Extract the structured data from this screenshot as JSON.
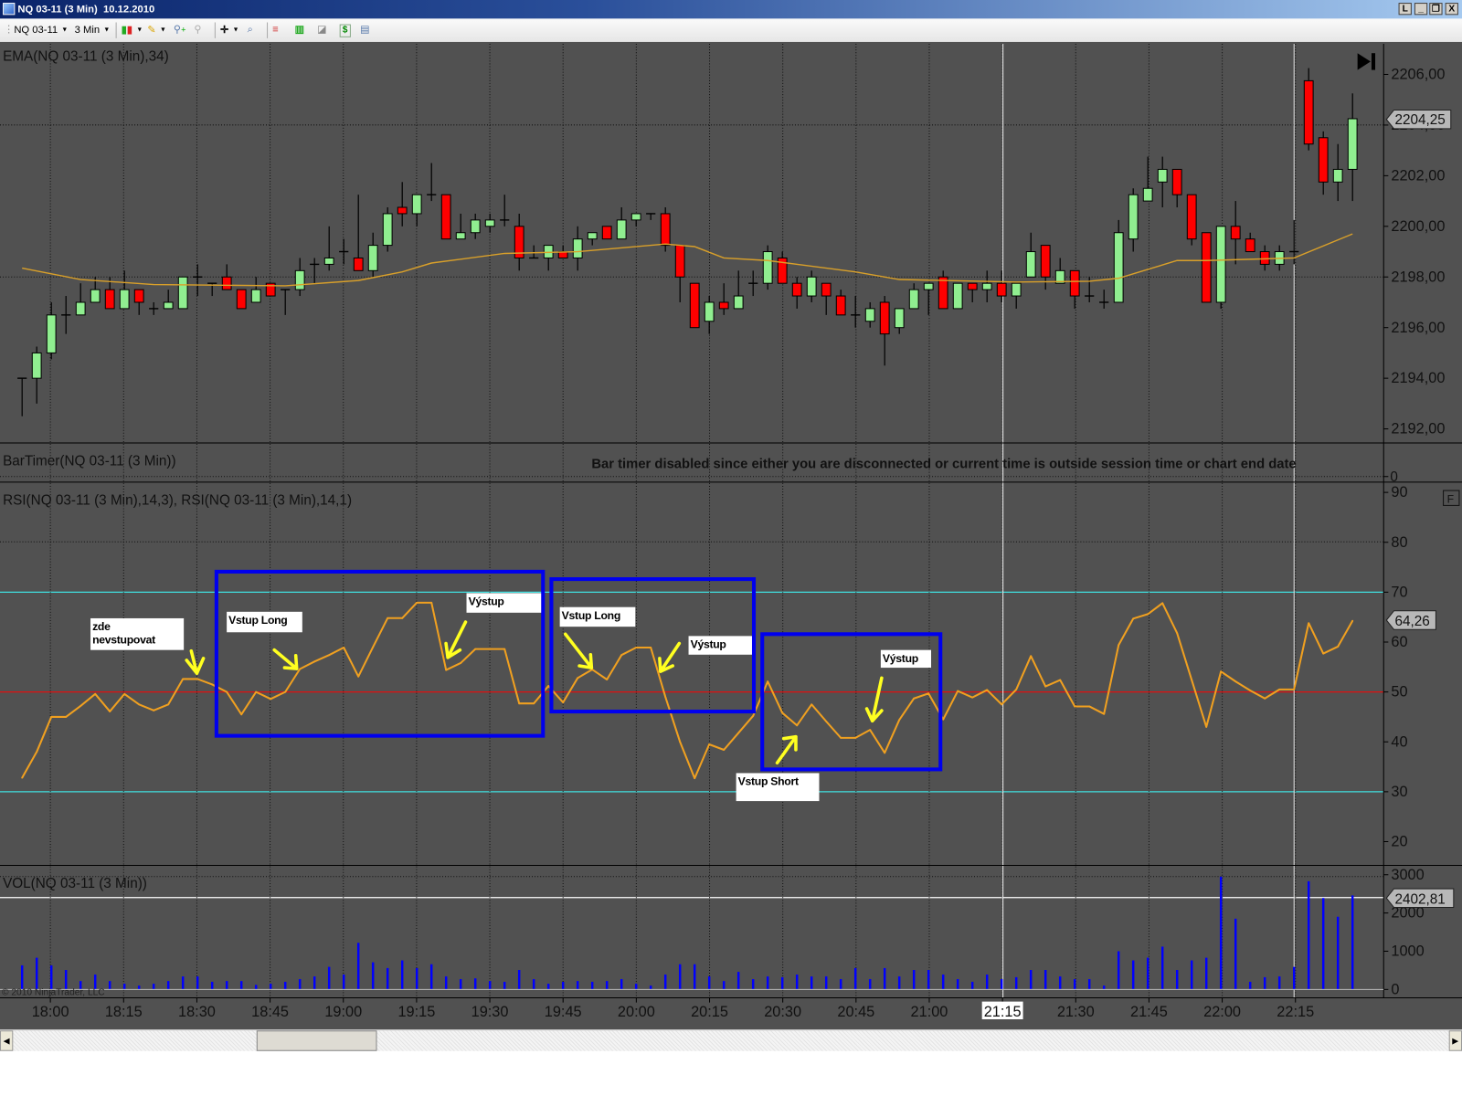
{
  "window": {
    "title": "NQ 03-11 (3 Min)  10.12.2010",
    "buttons": {
      "link": "L",
      "minimize": "_",
      "restore": "❐",
      "close": "X"
    }
  },
  "toolbar": {
    "instrument": "NQ 03-11",
    "interval": "3 Min",
    "icons": [
      "chart-style-icon",
      "drawing-pencil-icon",
      "zoom-in-icon",
      "zoom-out-icon",
      "crosshair-icon",
      "magnifier-icon",
      "strategies-icon",
      "indicators-icon",
      "data-box-icon",
      "order-entry-icon",
      "properties-icon"
    ]
  },
  "panels": {
    "price": {
      "label": "EMA(NQ 03-11 (3 Min),34)",
      "axis_labels": [
        "2206,00",
        "2204,00",
        "2202,00",
        "2200,00",
        "2198,00",
        "2196,00",
        "2194,00",
        "2192,00"
      ],
      "last_price": "2204,25"
    },
    "bartimer": {
      "label": "BarTimer(NQ 03-11 (3 Min))",
      "message": "Bar timer disabled since either you are disconnected or current time is outside session time or chart end date",
      "axis_label": "0"
    },
    "rsi": {
      "label": "RSI(NQ 03-11 (3 Min),14,3), RSI(NQ 03-11 (3 Min),14,1)",
      "axis_labels": [
        "90",
        "80",
        "70",
        "60",
        "50",
        "40",
        "30",
        "20"
      ],
      "last_value": "64,26",
      "f_button": "F",
      "upper_level": 70,
      "mid_level": 50,
      "lower_level": 30
    },
    "volume": {
      "label": "VOL(NQ 03-11 (3 Min))",
      "axis_labels": [
        "3000",
        "2000",
        "1000",
        "0"
      ],
      "last_value": "2402,81"
    }
  },
  "time_axis": {
    "labels": [
      "18:00",
      "18:15",
      "18:30",
      "18:45",
      "19:00",
      "19:15",
      "19:30",
      "19:45",
      "20:00",
      "20:15",
      "20:30",
      "20:45",
      "21:00",
      "21:15",
      "21:30",
      "21:45",
      "22:00",
      "22:15"
    ],
    "highlighted": "21:15"
  },
  "copyright": "© 2010 NinjaTrader, LLC",
  "annotations": {
    "no_entry_line1": "zde",
    "no_entry_line2": "nevstupovat",
    "long_entry_1": "Vstup Long",
    "exit_1": "Výstup",
    "long_entry_2": "Vstup Long",
    "exit_2": "Výstup",
    "short_entry": "Vstup Short",
    "exit_3": "Výstup"
  },
  "colors": {
    "background": "#515151",
    "up_candle": "#90ee90",
    "down_candle": "#ff0000",
    "ema": "#d9a02a",
    "rsi": "#f0a020",
    "rsi_bands": "#40e0e0",
    "rsi_mid": "#e01010",
    "volume": "#0000ff",
    "annotation_box": "#0000ee",
    "annotation_arrow": "#ffff20"
  },
  "chart_data": {
    "type": "candlestick",
    "instrument": "NQ 03-11",
    "interval": "3 Min",
    "times": [
      "17:54",
      "17:57",
      "18:00",
      "18:03",
      "18:06",
      "18:09",
      "18:12",
      "18:15",
      "18:18",
      "18:21",
      "18:24",
      "18:27",
      "18:30",
      "18:33",
      "18:36",
      "18:39",
      "18:42",
      "18:45",
      "18:48",
      "18:51",
      "18:54",
      "18:57",
      "19:00",
      "19:03",
      "19:06",
      "19:09",
      "19:12",
      "19:15",
      "19:18",
      "19:21",
      "19:24",
      "19:27",
      "19:30",
      "19:33",
      "19:36",
      "19:39",
      "19:42",
      "19:45",
      "19:48",
      "19:51",
      "19:54",
      "19:57",
      "20:00",
      "20:03",
      "20:06",
      "20:09",
      "20:12",
      "20:15",
      "20:18",
      "20:21",
      "20:24",
      "20:27",
      "20:30",
      "20:33",
      "20:36",
      "20:39",
      "20:42",
      "20:45",
      "20:48",
      "20:51",
      "20:54",
      "20:57",
      "21:00",
      "21:03",
      "21:06",
      "21:09",
      "21:12",
      "21:15",
      "21:18",
      "21:21",
      "21:24",
      "21:27",
      "21:30",
      "21:33",
      "21:36",
      "21:39",
      "21:42",
      "21:45",
      "21:48",
      "21:51",
      "21:54",
      "21:57",
      "22:00",
      "22:03",
      "22:06",
      "22:09",
      "22:12",
      "22:15",
      "22:18",
      "22:21",
      "22:24",
      "22:27"
    ],
    "open": [
      2194,
      2194,
      2195,
      2196.5,
      2196.5,
      2197,
      2197.5,
      2196.75,
      2197.5,
      2196.75,
      2196.75,
      2196.75,
      2198,
      2197.75,
      2198,
      2197.5,
      2197,
      2197.75,
      2197.5,
      2197.5,
      2198.5,
      2198.5,
      2199,
      2198.75,
      2198.25,
      2199.25,
      2200.75,
      2200.5,
      2201.25,
      2201.25,
      2199.5,
      2199.75,
      2200,
      2200.25,
      2200,
      2198.75,
      2198.75,
      2199,
      2198.75,
      2199.5,
      2200,
      2199.5,
      2200.25,
      2200.5,
      2200.5,
      2199.25,
      2197.75,
      2196.25,
      2197,
      2196.75,
      2197.75,
      2197.75,
      2198.75,
      2197.75,
      2197.25,
      2197.75,
      2197.25,
      2196.5,
      2196.25,
      2197,
      2196,
      2196.75,
      2197.5,
      2198,
      2196.75,
      2197.75,
      2197.5,
      2197.75,
      2197.25,
      2198,
      2199.25,
      2197.75,
      2198.25,
      2197.25,
      2197,
      2197,
      2199.5,
      2201,
      2201.75,
      2202.25,
      2201.25,
      2199.75,
      2197,
      2200,
      2199.5,
      2199,
      2198.5,
      2199,
      2205.75,
      2203.5,
      2201.75,
      2202.25
    ],
    "high": [
      2194,
      2195.25,
      2197,
      2197.25,
      2197.75,
      2198,
      2198,
      2198.25,
      2197.5,
      2197,
      2197.5,
      2198,
      2198.5,
      2197.75,
      2198.5,
      2197.5,
      2198,
      2197.75,
      2197.5,
      2198.75,
      2198.75,
      2200,
      2199.5,
      2201.25,
      2199.75,
      2200.75,
      2201.75,
      2201.25,
      2202.5,
      2201.25,
      2200.5,
      2200.5,
      2200.5,
      2201.25,
      2200.5,
      2199.25,
      2199.25,
      2199.25,
      2200,
      2199.75,
      2200,
      2200.75,
      2200.5,
      2200.5,
      2200.75,
      2199.25,
      2197.75,
      2197.25,
      2197.75,
      2198.25,
      2198.25,
      2199.25,
      2199,
      2198,
      2198.25,
      2197.75,
      2197.5,
      2197.25,
      2197,
      2197.25,
      2196.75,
      2197.75,
      2197.75,
      2198.25,
      2197.75,
      2197.75,
      2198.25,
      2198.25,
      2197.75,
      2199.75,
      2199.25,
      2198.75,
      2198.25,
      2198,
      2197.5,
      2200.25,
      2201.5,
      2202.75,
      2202.75,
      2202.25,
      2201.25,
      2199.75,
      2200,
      2201,
      2199.75,
      2199.25,
      2199.25,
      2200.25,
      2206.25,
      2203.75,
      2203.25,
      2205.25
    ],
    "low": [
      2192.5,
      2193,
      2194.75,
      2195.75,
      2196.5,
      2197,
      2196.75,
      2196.75,
      2196.5,
      2196.5,
      2196.75,
      2196.75,
      2197.25,
      2197.25,
      2197.5,
      2196.75,
      2197,
      2197.25,
      2196.5,
      2197.25,
      2197.75,
      2198.25,
      2198.5,
      2198.25,
      2198,
      2199,
      2200,
      2200,
      2201,
      2199.5,
      2199.5,
      2199.5,
      2199.75,
      2200,
      2198.25,
      2198.75,
      2198.25,
      2198.75,
      2198.25,
      2199.25,
      2199.5,
      2199.5,
      2200,
      2200.25,
      2199,
      2197,
      2196,
      2195.75,
      2196.5,
      2196.75,
      2197.25,
      2197.5,
      2197.75,
      2196.75,
      2197,
      2196.5,
      2196.5,
      2196,
      2196,
      2194.5,
      2195.75,
      2196.75,
      2196.5,
      2196.75,
      2196.75,
      2197,
      2197,
      2197,
      2196.75,
      2198,
      2197.5,
      2197.75,
      2196.75,
      2197,
      2196.75,
      2197,
      2199,
      2201,
      2200.75,
      2200.75,
      2199.25,
      2197,
      2196.75,
      2198.5,
      2199,
      2198.25,
      2198.25,
      2198.5,
      2203,
      2201.25,
      2201,
      2201
    ],
    "close": [
      2194,
      2195,
      2196.5,
      2196.5,
      2197,
      2197.5,
      2196.75,
      2197.5,
      2197,
      2196.75,
      2197,
      2198,
      2198,
      2197.75,
      2197.5,
      2196.75,
      2197.5,
      2197.25,
      2197.5,
      2198.25,
      2198.5,
      2198.75,
      2199,
      2198.25,
      2199.25,
      2200.5,
      2200.5,
      2201.25,
      2201.25,
      2199.5,
      2199.75,
      2200.25,
      2200.25,
      2200.25,
      2198.75,
      2198.75,
      2199.25,
      2198.75,
      2199.5,
      2199.75,
      2199.5,
      2200.25,
      2200.5,
      2200.5,
      2199.25,
      2198,
      2196,
      2197,
      2196.75,
      2197.25,
      2197.75,
      2199,
      2197.75,
      2197.25,
      2198,
      2197.25,
      2196.5,
      2196.5,
      2196.75,
      2195.75,
      2196.75,
      2197.5,
      2197.75,
      2196.75,
      2197.75,
      2197.5,
      2197.75,
      2197.25,
      2197.75,
      2199,
      2198,
      2198.25,
      2197.25,
      2197.25,
      2197,
      2199.75,
      2201.25,
      2201.5,
      2202.25,
      2201.25,
      2199.5,
      2197,
      2200,
      2199.5,
      2199,
      2198.5,
      2199,
      2199,
      2203.25,
      2201.75,
      2202.25,
      2204.25
    ],
    "ema_34": [
      [
        "17:54",
        2198.35
      ],
      [
        "18:06",
        2197.9
      ],
      [
        "18:21",
        2197.7
      ],
      [
        "18:48",
        2197.65
      ],
      [
        "19:03",
        2197.86
      ],
      [
        "19:12",
        2198.2
      ],
      [
        "19:18",
        2198.55
      ],
      [
        "19:33",
        2198.93
      ],
      [
        "19:48",
        2199.0
      ],
      [
        "20:06",
        2199.3
      ],
      [
        "20:12",
        2199.2
      ],
      [
        "20:18",
        2198.75
      ],
      [
        "20:27",
        2198.65
      ],
      [
        "20:45",
        2198.2
      ],
      [
        "20:54",
        2197.9
      ],
      [
        "21:18",
        2197.8
      ],
      [
        "21:33",
        2197.83
      ],
      [
        "21:39",
        2197.95
      ],
      [
        "21:45",
        2198.3
      ],
      [
        "21:51",
        2198.65
      ],
      [
        "21:57",
        2198.65
      ],
      [
        "22:15",
        2198.75
      ],
      [
        "22:27",
        2199.7
      ]
    ],
    "rsi": [
      32.8,
      38.0,
      45.0,
      45.0,
      47.2,
      49.6,
      46.1,
      49.6,
      47.5,
      46.3,
      47.5,
      52.6,
      52.6,
      51.5,
      50.0,
      45.5,
      50.0,
      48.6,
      50.0,
      54.6,
      56.1,
      57.4,
      58.9,
      53.1,
      59.0,
      64.8,
      64.8,
      67.9,
      67.9,
      54.4,
      55.8,
      58.6,
      58.6,
      58.6,
      47.7,
      47.7,
      51.2,
      47.9,
      52.8,
      54.5,
      52.5,
      57.4,
      58.9,
      58.9,
      49.0,
      40.0,
      32.7,
      39.5,
      38.4,
      41.8,
      45.2,
      52.1,
      45.8,
      43.3,
      47.5,
      44.1,
      40.8,
      40.8,
      42.4,
      37.8,
      44.4,
      48.7,
      49.7,
      44.5,
      50.2,
      48.9,
      50.4,
      47.5,
      50.5,
      57.2,
      51.1,
      52.4,
      47.1,
      47.1,
      45.6,
      59.4,
      64.7,
      65.6,
      67.8,
      61.8,
      52.4,
      43.0,
      54.1,
      52.1,
      50.3,
      48.7,
      50.5,
      50.5,
      63.8,
      57.7,
      59.1,
      64.26
    ],
    "volume": [
      630,
      830,
      630,
      510,
      220,
      390,
      220,
      150,
      100,
      150,
      220,
      340,
      340,
      200,
      220,
      220,
      120,
      150,
      200,
      270,
      340,
      590,
      390,
      1220,
      710,
      560,
      760,
      560,
      660,
      340,
      270,
      290,
      220,
      200,
      510,
      270,
      150,
      200,
      220,
      200,
      220,
      270,
      150,
      100,
      390,
      660,
      660,
      340,
      220,
      460,
      270,
      340,
      320,
      390,
      340,
      340,
      270,
      560,
      270,
      560,
      340,
      510,
      510,
      390,
      270,
      200,
      390,
      270,
      320,
      510,
      510,
      340,
      270,
      270,
      100,
      1000,
      760,
      830,
      1120,
      510,
      760,
      830,
      2950,
      1850,
      200,
      320,
      340,
      590,
      2830,
      2390,
      1900,
      2460
    ],
    "price_range": [
      2191.5,
      2207
    ],
    "rsi_range": [
      15,
      95
    ],
    "volume_range": [
      0,
      3000
    ],
    "grid": true
  }
}
